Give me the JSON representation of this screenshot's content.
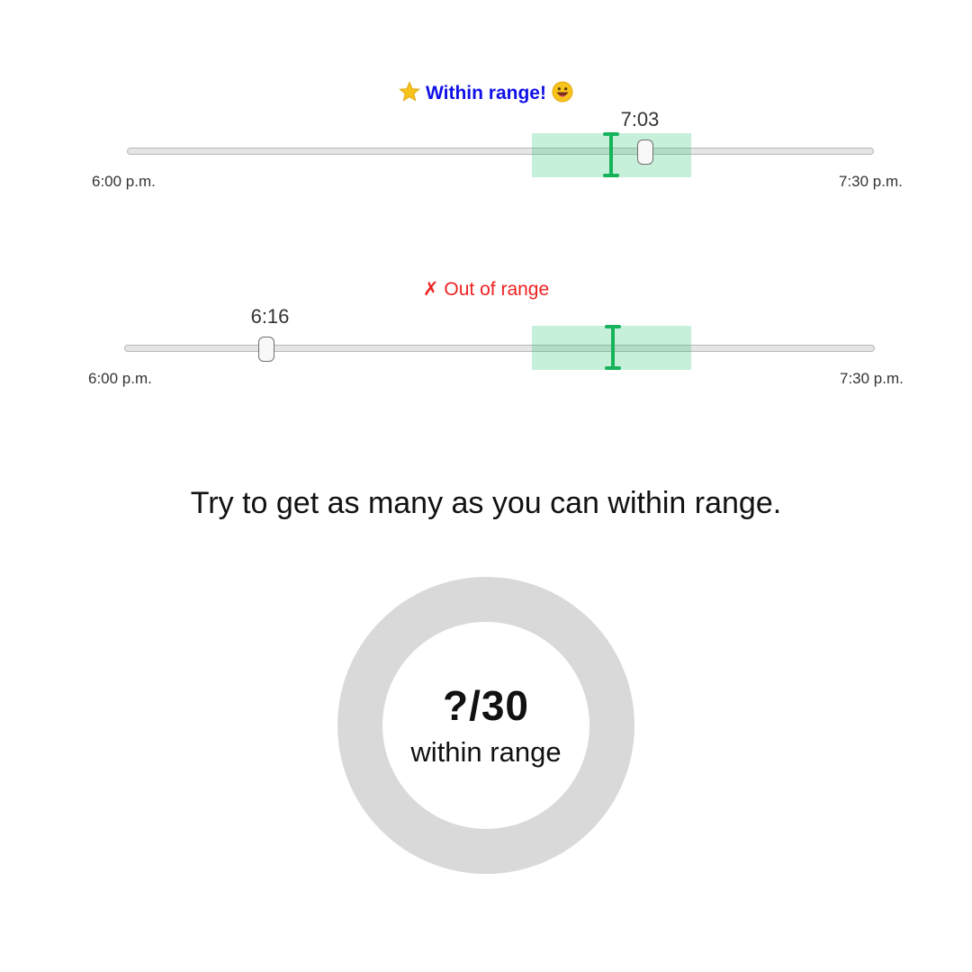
{
  "sliders": [
    {
      "status_text": "Within range!",
      "status_state": "within",
      "status_color": "#1010e8",
      "status_icons": [
        "star-icon",
        "grinning-face-icon"
      ],
      "value_label": "7:03",
      "min_label": "6:00 p.m.",
      "max_label": "7:30 p.m."
    },
    {
      "status_text": "Out of range",
      "status_state": "out",
      "status_color": "#ee2222",
      "status_icon_glyph": "✗",
      "status_icons": [
        "x-icon"
      ],
      "value_label": "6:16",
      "min_label": "6:00 p.m.",
      "max_label": "7:30 p.m."
    }
  ],
  "target_band_color": "#c7efdb",
  "target_marker_color": "#16b35c",
  "instruction": "Try to get as many as you can within range.",
  "score": {
    "value": "?/30",
    "caption": "within range",
    "ring_color": "#d9d9d9"
  }
}
